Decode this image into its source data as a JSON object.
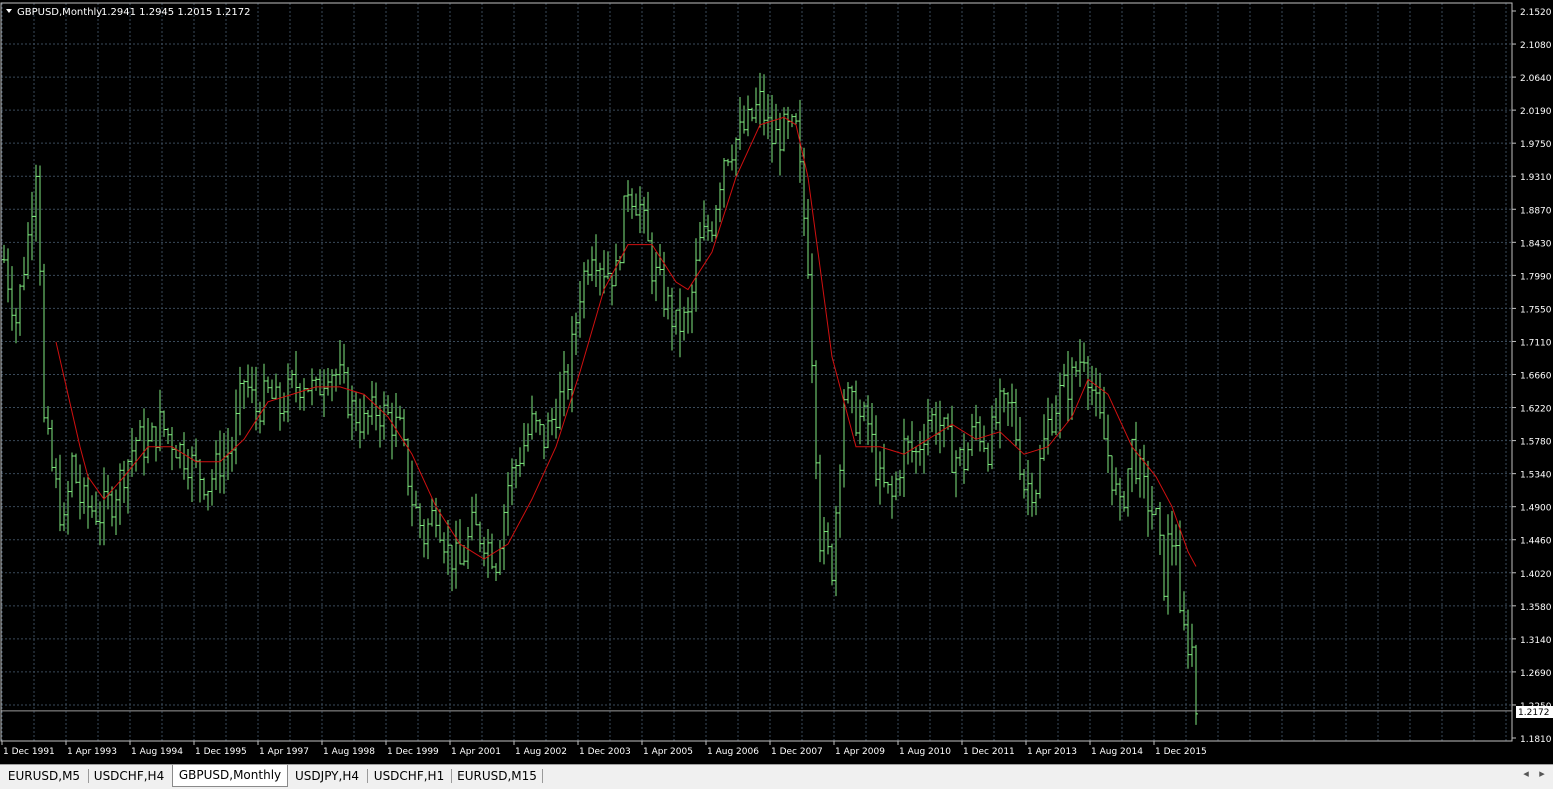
{
  "chart": {
    "symbol_label": "GBPUSD,Monthly",
    "ohlc_label": "1.2941 1.2945 1.2015 1.2172",
    "current_price_label": "1.2172",
    "price_axis_labels": [
      "2.1520",
      "2.1080",
      "2.0640",
      "2.0190",
      "1.9750",
      "1.9310",
      "1.8870",
      "1.8430",
      "1.7990",
      "1.7550",
      "1.7110",
      "1.6660",
      "1.6220",
      "1.5780",
      "1.5340",
      "1.4900",
      "1.4460",
      "1.4020",
      "1.3580",
      "1.3140",
      "1.2690",
      "1.2250",
      "1.1810"
    ],
    "time_axis_labels": [
      "1 Dec 1991",
      "1 Apr 1993",
      "1 Aug 1994",
      "1 Dec 1995",
      "1 Apr 1997",
      "1 Aug 1998",
      "1 Dec 1999",
      "1 Apr 2001",
      "1 Aug 2002",
      "1 Dec 2003",
      "1 Apr 2005",
      "1 Aug 2006",
      "1 Dec 2007",
      "1 Apr 2009",
      "1 Aug 2010",
      "1 Dec 2011",
      "1 Apr 2013",
      "1 Aug 2014",
      "1 Dec 2015"
    ],
    "colors": {
      "background": "#000000",
      "grid": "#3a4a5a",
      "bars": "#7fe87f",
      "moving_average": "#d01010",
      "axis_text": "#ffffff",
      "axis_line": "#c0c0c0"
    }
  },
  "chart_data": {
    "type": "line",
    "ylim": [
      1.181,
      2.152
    ],
    "x_range": [
      "1991-12",
      "2016-10"
    ],
    "series": [
      {
        "values": [
          [
            "1991-12",
            1.82
          ],
          [
            "1992-03",
            1.74
          ],
          [
            "1992-06",
            1.85
          ],
          [
            "1992-08",
            1.95
          ],
          [
            "1992-09",
            1.82
          ],
          [
            "1992-10",
            1.6
          ],
          [
            "1992-12",
            1.54
          ],
          [
            "1993-03",
            1.46
          ],
          [
            "1993-05",
            1.55
          ],
          [
            "1993-07",
            1.5
          ],
          [
            "1993-09",
            1.49
          ],
          [
            "1993-12",
            1.48
          ],
          [
            "1994-03",
            1.5
          ],
          [
            "1994-06",
            1.54
          ],
          [
            "1994-09",
            1.58
          ],
          [
            "1994-12",
            1.57
          ],
          [
            "1995-03",
            1.6
          ],
          [
            "1995-06",
            1.58
          ],
          [
            "1995-09",
            1.56
          ],
          [
            "1995-12",
            1.54
          ],
          [
            "1996-03",
            1.52
          ],
          [
            "1996-06",
            1.55
          ],
          [
            "1996-09",
            1.57
          ],
          [
            "1996-12",
            1.66
          ],
          [
            "1997-03",
            1.62
          ],
          [
            "1997-06",
            1.64
          ],
          [
            "1997-09",
            1.62
          ],
          [
            "1997-12",
            1.65
          ],
          [
            "1998-03",
            1.66
          ],
          [
            "1998-06",
            1.64
          ],
          [
            "1998-09",
            1.68
          ],
          [
            "1998-12",
            1.66
          ],
          [
            "1999-03",
            1.62
          ],
          [
            "1999-06",
            1.6
          ],
          [
            "1999-09",
            1.62
          ],
          [
            "1999-12",
            1.61
          ],
          [
            "2000-03",
            1.59
          ],
          [
            "2000-06",
            1.5
          ],
          [
            "2000-09",
            1.45
          ],
          [
            "2000-12",
            1.49
          ],
          [
            "2001-03",
            1.43
          ],
          [
            "2001-06",
            1.41
          ],
          [
            "2001-09",
            1.46
          ],
          [
            "2001-12",
            1.45
          ],
          [
            "2002-03",
            1.42
          ],
          [
            "2002-06",
            1.52
          ],
          [
            "2002-09",
            1.56
          ],
          [
            "2002-12",
            1.6
          ],
          [
            "2003-03",
            1.58
          ],
          [
            "2003-06",
            1.62
          ],
          [
            "2003-09",
            1.66
          ],
          [
            "2003-12",
            1.78
          ],
          [
            "2004-03",
            1.84
          ],
          [
            "2004-06",
            1.81
          ],
          [
            "2004-09",
            1.8
          ],
          [
            "2004-12",
            1.92
          ],
          [
            "2005-03",
            1.89
          ],
          [
            "2005-06",
            1.81
          ],
          [
            "2005-09",
            1.77
          ],
          [
            "2005-12",
            1.73
          ],
          [
            "2006-03",
            1.74
          ],
          [
            "2006-06",
            1.84
          ],
          [
            "2006-09",
            1.87
          ],
          [
            "2006-12",
            1.96
          ],
          [
            "2007-03",
            1.98
          ],
          [
            "2007-06",
            2.0
          ],
          [
            "2007-09",
            2.03
          ],
          [
            "2007-12",
            1.98
          ],
          [
            "2008-03",
            1.99
          ],
          [
            "2008-06",
            1.99
          ],
          [
            "2008-09",
            1.82
          ],
          [
            "2008-12",
            1.45
          ],
          [
            "2009-03",
            1.41
          ],
          [
            "2009-06",
            1.64
          ],
          [
            "2009-09",
            1.61
          ],
          [
            "2009-12",
            1.6
          ],
          [
            "2010-03",
            1.52
          ],
          [
            "2010-06",
            1.5
          ],
          [
            "2010-09",
            1.57
          ],
          [
            "2010-12",
            1.56
          ],
          [
            "2011-03",
            1.61
          ],
          [
            "2011-06",
            1.6
          ],
          [
            "2011-09",
            1.56
          ],
          [
            "2011-12",
            1.55
          ],
          [
            "2012-03",
            1.6
          ],
          [
            "2012-06",
            1.57
          ],
          [
            "2012-09",
            1.62
          ],
          [
            "2012-12",
            1.62
          ],
          [
            "2013-03",
            1.52
          ],
          [
            "2013-06",
            1.52
          ],
          [
            "2013-09",
            1.6
          ],
          [
            "2013-12",
            1.64
          ],
          [
            "2014-03",
            1.66
          ],
          [
            "2014-06",
            1.7
          ],
          [
            "2014-09",
            1.62
          ],
          [
            "2014-12",
            1.56
          ],
          [
            "2015-03",
            1.48
          ],
          [
            "2015-06",
            1.57
          ],
          [
            "2015-09",
            1.51
          ],
          [
            "2015-12",
            1.47
          ],
          [
            "2016-02",
            1.39
          ],
          [
            "2016-03",
            1.44
          ],
          [
            "2016-05",
            1.45
          ],
          [
            "2016-06",
            1.33
          ],
          [
            "2016-08",
            1.31
          ],
          [
            "2016-09",
            1.3
          ],
          [
            "2016-10",
            1.22
          ]
        ]
      },
      {
        "values": [
          [
            "1993-01",
            1.71
          ],
          [
            "1993-04",
            1.64
          ],
          [
            "1993-07",
            1.57
          ],
          [
            "1993-09",
            1.53
          ],
          [
            "1994-01",
            1.5
          ],
          [
            "1994-06",
            1.53
          ],
          [
            "1994-12",
            1.57
          ],
          [
            "1995-06",
            1.57
          ],
          [
            "1995-12",
            1.55
          ],
          [
            "1996-06",
            1.55
          ],
          [
            "1996-12",
            1.58
          ],
          [
            "1997-06",
            1.63
          ],
          [
            "1997-12",
            1.64
          ],
          [
            "1998-06",
            1.65
          ],
          [
            "1998-12",
            1.65
          ],
          [
            "1999-06",
            1.64
          ],
          [
            "1999-12",
            1.61
          ],
          [
            "2000-06",
            1.56
          ],
          [
            "2000-12",
            1.49
          ],
          [
            "2001-06",
            1.44
          ],
          [
            "2001-12",
            1.42
          ],
          [
            "2002-06",
            1.44
          ],
          [
            "2002-12",
            1.5
          ],
          [
            "2003-06",
            1.57
          ],
          [
            "2003-12",
            1.67
          ],
          [
            "2004-06",
            1.78
          ],
          [
            "2004-12",
            1.84
          ],
          [
            "2005-06",
            1.84
          ],
          [
            "2005-12",
            1.79
          ],
          [
            "2006-03",
            1.78
          ],
          [
            "2006-09",
            1.83
          ],
          [
            "2007-03",
            1.93
          ],
          [
            "2007-09",
            2.0
          ],
          [
            "2008-03",
            2.01
          ],
          [
            "2008-06",
            2.0
          ],
          [
            "2008-09",
            1.93
          ],
          [
            "2009-03",
            1.69
          ],
          [
            "2009-09",
            1.57
          ],
          [
            "2010-03",
            1.57
          ],
          [
            "2010-09",
            1.56
          ],
          [
            "2011-03",
            1.58
          ],
          [
            "2011-09",
            1.6
          ],
          [
            "2012-03",
            1.58
          ],
          [
            "2012-09",
            1.59
          ],
          [
            "2013-03",
            1.56
          ],
          [
            "2013-09",
            1.57
          ],
          [
            "2014-03",
            1.61
          ],
          [
            "2014-07",
            1.66
          ],
          [
            "2014-12",
            1.64
          ],
          [
            "2015-06",
            1.57
          ],
          [
            "2015-12",
            1.53
          ],
          [
            "2016-04",
            1.49
          ],
          [
            "2016-08",
            1.43
          ],
          [
            "2016-10",
            1.41
          ]
        ]
      }
    ]
  },
  "tabs": [
    {
      "label": "EURUSD,M5",
      "active": false
    },
    {
      "label": "USDCHF,H4",
      "active": false
    },
    {
      "label": "GBPUSD,Monthly",
      "active": true
    },
    {
      "label": "USDJPY,H4",
      "active": false
    },
    {
      "label": "USDCHF,H1",
      "active": false
    },
    {
      "label": "EURUSD,M15",
      "active": false
    }
  ],
  "tab_scroll": {
    "left": "◂",
    "right": "▸"
  }
}
